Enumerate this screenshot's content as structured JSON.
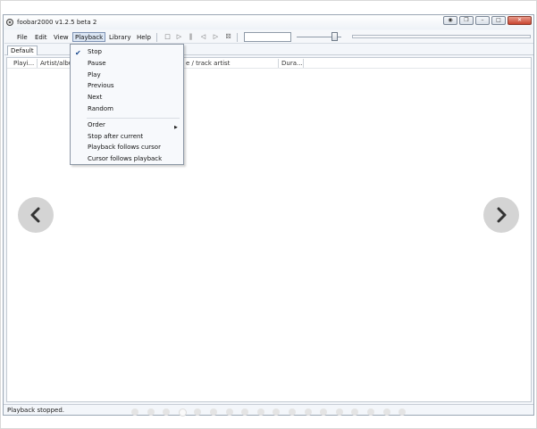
{
  "window": {
    "title": "foobar2000 v1.2.5 beta 2",
    "buttons": [
      "◉",
      "❒",
      "–",
      "□",
      "✕"
    ]
  },
  "menubar": {
    "items": [
      "File",
      "Edit",
      "View",
      "Playback",
      "Library",
      "Help"
    ],
    "open_item": "Playback"
  },
  "toolbar": {
    "icons": [
      "stop-icon",
      "play-icon",
      "pause-icon",
      "previous-icon",
      "next-icon",
      "random-icon"
    ],
    "glyphs": [
      "□",
      "▷",
      "‖",
      "◁",
      "▷",
      "⚄"
    ]
  },
  "tabs": [
    "Default"
  ],
  "playlist": {
    "columns": [
      "Playi...",
      "Artist/album",
      "e / track artist",
      "Dura..."
    ]
  },
  "playback_menu": {
    "items": [
      {
        "label": "Stop",
        "checked": true
      },
      {
        "label": "Pause"
      },
      {
        "label": "Play"
      },
      {
        "label": "Previous"
      },
      {
        "label": "Next"
      },
      {
        "label": "Random"
      },
      {
        "label": "Order",
        "submenu": true
      },
      {
        "label": "Stop after current"
      },
      {
        "label": "Playback follows cursor"
      },
      {
        "label": "Cursor follows playback"
      }
    ],
    "check_glyph": "✔",
    "submenu_glyph": "▶"
  },
  "status": {
    "text": "Playback stopped."
  },
  "carousel": {
    "dot_count": 18,
    "active_index": 3
  },
  "colors": {
    "close_button": "#c8442f",
    "menu_highlight": "#dbe6f4",
    "nav_button": "#d2d2d2"
  }
}
